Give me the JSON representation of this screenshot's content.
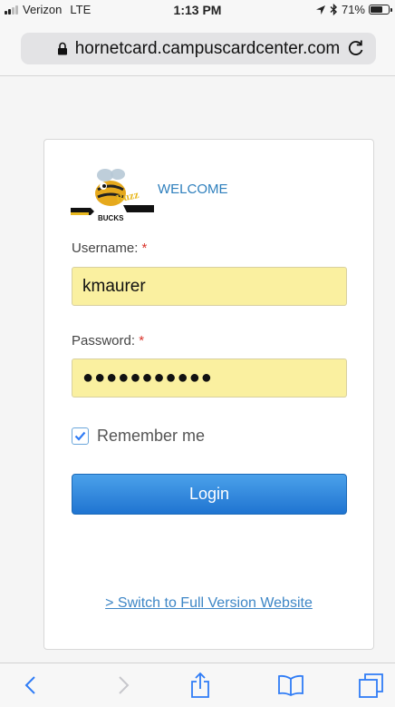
{
  "status_bar": {
    "carrier": "Verizon",
    "network": "LTE",
    "time": "1:13 PM",
    "battery": "71%",
    "battery_level": 0.71
  },
  "browser": {
    "url": "hornetcard.campuscardcenter.com"
  },
  "login": {
    "logo_text": "BUCKS",
    "welcome": "WELCOME",
    "username_label": "Username:",
    "username_value": "kmaurer",
    "password_label": "Password:",
    "password_value": "●●●●●●●●●●●",
    "required_mark": "*",
    "remember_label": "Remember me",
    "remember_checked": true,
    "login_button": "Login",
    "full_version_link": "> Switch to Full Version Website"
  },
  "toolbar_icons": [
    "back-icon",
    "forward-icon",
    "share-icon",
    "bookmarks-icon",
    "tabs-icon"
  ],
  "colors": {
    "accent": "#1f74d1",
    "link": "#3d86c6",
    "field_autofill": "#faf0a0",
    "required": "#d9342b",
    "ios_blue": "#2f7cf6"
  }
}
